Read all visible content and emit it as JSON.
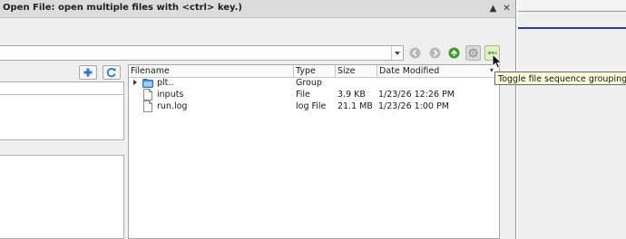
{
  "dialog": {
    "title": "Open File:  open multiple files with <ctrl> key.)",
    "minimize_glyph": "▲",
    "close_glyph": "✕"
  },
  "toolbar": {
    "path_value": "",
    "back_icon": "arrow-left-icon",
    "forward_icon": "arrow-right-icon",
    "up_icon": "arrow-up-icon",
    "settings_icon": "gear-icon",
    "group_icon": "file-sequence-group-icon"
  },
  "left_pane": {
    "add_icon": "plus-icon",
    "refresh_icon": "refresh-icon"
  },
  "file_list": {
    "columns": [
      "Filename",
      "Type",
      "Size",
      "Date Modified"
    ],
    "sort_indicator": "▾",
    "rows": [
      {
        "name": "plt..",
        "type": "Group",
        "size": "",
        "date": "",
        "icon": "folder-icon",
        "expandable": true
      },
      {
        "name": "inputs",
        "type": "File",
        "size": "3.9 KB",
        "date": "1/23/26 12:26 PM",
        "icon": "file-icon",
        "expandable": false
      },
      {
        "name": "run.log",
        "type": "log File",
        "size": "21.1 MB",
        "date": "1/23/26 1:00 PM",
        "icon": "file-icon",
        "expandable": false
      }
    ]
  },
  "tooltip": {
    "text": "Toggle file sequence grouping."
  },
  "colors": {
    "accent_green": "#3a9a2a",
    "accent_blue": "#2f79c8",
    "tooltip_bg": "#ffffdc",
    "right_window_line": "#2d3aa3"
  }
}
